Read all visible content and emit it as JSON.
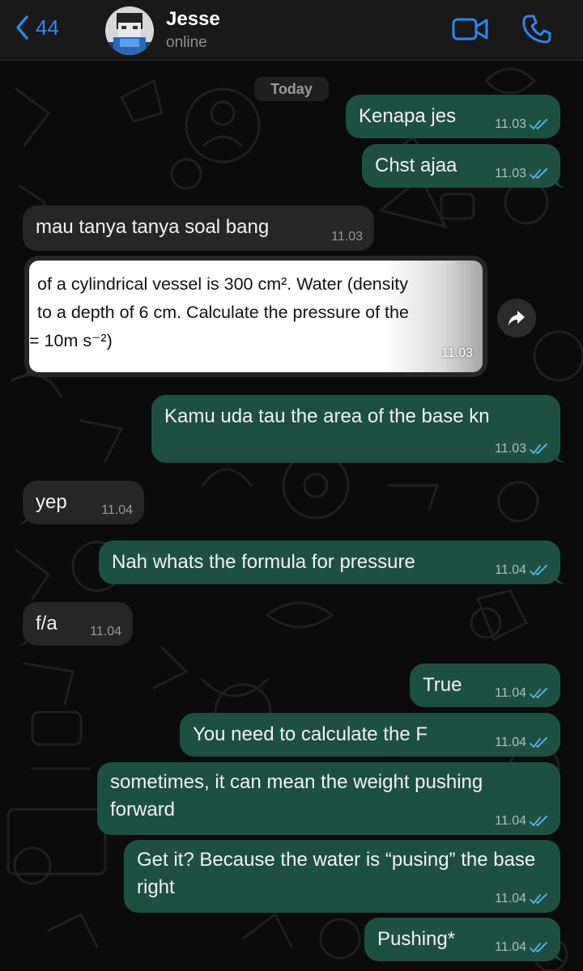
{
  "header": {
    "back_count": "44",
    "contact_name": "Jesse",
    "contact_status": "online"
  },
  "day_label": "Today",
  "messages": [
    {
      "text": "Kenapa jes",
      "time": "11.03"
    },
    {
      "text": "Chst ajaa",
      "time": "11.03"
    },
    {
      "text": "mau tanya tanya soal bang",
      "time": "11.03"
    },
    {
      "image_lines": [
        "of a cylindrical vessel is 300 cm². Water (density",
        "to a depth of 6 cm. Calculate the pressure of the",
        "= 10m s⁻²)"
      ],
      "time": "11.03"
    },
    {
      "text": "Kamu uda tau the area of the base kn",
      "time": "11.03"
    },
    {
      "text": "yep",
      "time": "11.04"
    },
    {
      "text": "Nah whats the formula for pressure",
      "time": "11.04"
    },
    {
      "text": "f/a",
      "time": "11.04"
    },
    {
      "text": "True",
      "time": "11.04"
    },
    {
      "text": "You need to calculate the F",
      "time": "11.04"
    },
    {
      "text": "sometimes, it can mean the weight pushing forward",
      "time": "11.04"
    },
    {
      "text": "Get it? Because the water is “pusing” the base right",
      "time": "11.04"
    },
    {
      "text": "Pushing*",
      "time": "11.04"
    }
  ],
  "colors": {
    "accent": "#2f86ee",
    "outgoing_bubble": "#1e5042",
    "incoming_bubble": "#262626",
    "read_tick": "#53bdeb"
  },
  "icons": [
    "back-chevron-icon",
    "video-camera-icon",
    "phone-icon",
    "forward-icon",
    "double-check-icon"
  ]
}
